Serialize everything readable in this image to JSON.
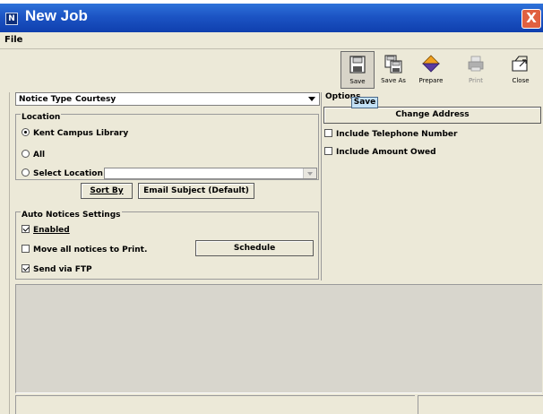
{
  "window": {
    "title": "New Job",
    "title_icon": "job-window-icon",
    "close_glyph": "X"
  },
  "menu": {
    "items": [
      "File"
    ]
  },
  "toolbar": {
    "buttons": [
      {
        "label": "Save",
        "icon": "save-icon",
        "state": "pressed"
      },
      {
        "label": "Save As",
        "icon": "save-as-icon",
        "state": "enabled"
      },
      {
        "label": "Prepare",
        "icon": "prepare-icon",
        "state": "enabled"
      },
      {
        "label": "Print",
        "icon": "print-icon",
        "state": "disabled"
      },
      {
        "label": "Close",
        "icon": "close-folder-icon",
        "state": "enabled"
      }
    ]
  },
  "tooltip": {
    "text": "Save"
  },
  "notice_type": {
    "label": "Notice Type",
    "value": "Courtesy"
  },
  "location": {
    "title": "Location",
    "options": [
      "Kent Campus Library",
      "All",
      "Select Location"
    ],
    "selected": "Kent Campus Library",
    "select_location_value": ""
  },
  "actions": {
    "sort_by": "Sort By",
    "email_subject": "Email Subject (Default)"
  },
  "auto_notices": {
    "title": "Auto Notices Settings",
    "enabled_label": "Enabled",
    "enabled_checked": true,
    "move_label": "Move all notices to Print.",
    "move_checked": false,
    "schedule_label": "Schedule",
    "ftp_label": "Send via FTP",
    "ftp_checked": true
  },
  "options": {
    "title": "Options",
    "change_address": "Change Address",
    "include_phone_label": "Include Telephone Number",
    "include_phone_checked": false,
    "include_owed_label": "Include Amount Owed",
    "include_owed_checked": false
  },
  "colors": {
    "titlebar": "#1c54c4",
    "window_bg": "#ece9d8",
    "tooltip_bg": "#c4e2f6",
    "close_red": "#e06040"
  }
}
